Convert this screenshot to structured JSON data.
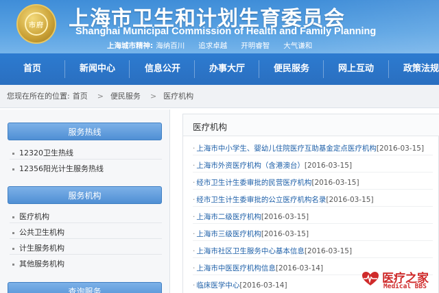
{
  "header": {
    "emblem_text": "市府",
    "title_cn": "上海市卫生和计划生育委员会",
    "title_en": "Shanghai Municipal Commission of Health and Family Planning",
    "spirit_label": "上海城市精神:",
    "spirit_values": [
      "海纳百川",
      "追求卓越",
      "开明睿智",
      "大气谦和"
    ]
  },
  "nav": {
    "items": [
      "首页",
      "新闻中心",
      "信息公开",
      "办事大厅",
      "便民服务",
      "网上互动",
      "政策法规"
    ]
  },
  "breadcrumb": {
    "label": "您现在所在的位置:",
    "items": [
      "首页",
      "便民服务",
      "医疗机构"
    ],
    "separator": ">"
  },
  "sidebar": {
    "sections": [
      {
        "title": "服务热线",
        "items": [
          "12320卫生热线",
          "12356阳光计生服务热线"
        ]
      },
      {
        "title": "服务机构",
        "items": [
          "医疗机构",
          "公共卫生机构",
          "计生服务机构",
          "其他服务机构"
        ]
      },
      {
        "title": "查询服务",
        "items": []
      }
    ]
  },
  "main": {
    "title": "医疗机构",
    "items": [
      {
        "text": "上海市中小学生、婴幼儿住院医疗互助基金定点医疗机构",
        "date": "[2016-03-15]"
      },
      {
        "text": "上海市外资医疗机构（含港澳台）",
        "date": "[2016-03-15]"
      },
      {
        "text": "经市卫生计生委审批的民营医疗机构",
        "date": "[2016-03-15]"
      },
      {
        "text": "经市卫生计生委审批的公立医疗机构名录",
        "date": "[2016-03-15]"
      },
      {
        "text": "上海市二级医疗机构",
        "date": "[2016-03-15]"
      },
      {
        "text": "上海市三级医疗机构",
        "date": "[2016-03-15]"
      },
      {
        "text": "上海市社区卫生服务中心基本信息",
        "date": "[2016-03-15]"
      },
      {
        "text": "上海市中医医疗机构信息",
        "date": "[2016-03-14]"
      },
      {
        "text": "临床医学中心",
        "date": "[2016-03-14]"
      }
    ]
  },
  "watermark": {
    "cn": "医疗之家",
    "en": "Medical BBS"
  },
  "colors": {
    "nav": "#2a6fc0",
    "header": "#5aa3e3",
    "link": "#1d5fa8",
    "watermark": "#cf2b2b"
  }
}
